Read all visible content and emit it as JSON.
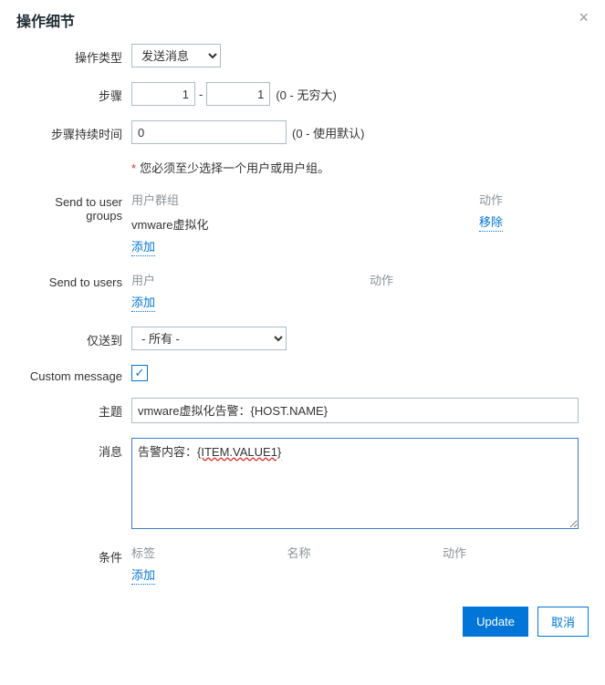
{
  "title": "操作细节",
  "labels": {
    "operation_type": "操作类型",
    "steps": "步骤",
    "step_duration": "步骤持续时间",
    "send_to_user_groups": "Send to user groups",
    "send_to_users": "Send to users",
    "send_only_to": "仅送到",
    "custom_message": "Custom message",
    "subject": "主题",
    "message": "消息",
    "conditions": "条件"
  },
  "operation_type": {
    "value": "发送消息"
  },
  "steps": {
    "from": "1",
    "to": "1",
    "hint": "(0 - 无穷大)"
  },
  "duration": {
    "value": "0",
    "hint": "(0 - 使用默认)"
  },
  "required_note": "您必须至少选择一个用户或用户组。",
  "user_groups_table": {
    "head_group": "用户群组",
    "head_action": "动作",
    "row_name": "vmware虚拟化",
    "row_action": "移除",
    "add": "添加"
  },
  "users_table": {
    "head_user": "用户",
    "head_action": "动作",
    "add": "添加"
  },
  "send_only_to": {
    "value": "- 所有 -"
  },
  "custom_message_checked": "✓",
  "subject": {
    "value": "vmware虚拟化告警：{HOST.NAME}"
  },
  "message": {
    "prefix": "告警内容：",
    "macro": "{ITEM.VALUE1}"
  },
  "conditions_table": {
    "head_tag": "标签",
    "head_name": "名称",
    "head_action": "动作",
    "add": "添加"
  },
  "buttons": {
    "update": "Update",
    "cancel": "取消"
  }
}
